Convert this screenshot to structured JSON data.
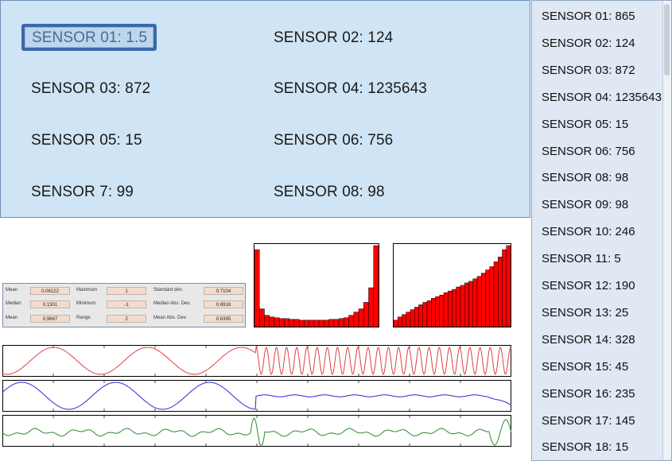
{
  "sensor_grid": [
    {
      "text": "SENSOR 01: 1.5",
      "selected": true
    },
    {
      "text": "SENSOR 02: 124"
    },
    {
      "text": "SENSOR 03: 872"
    },
    {
      "text": "SENSOR 04: 1235643"
    },
    {
      "text": "SENSOR 05: 15"
    },
    {
      "text": "SENSOR 06: 756"
    },
    {
      "text": "SENSOR 7: 99"
    },
    {
      "text": "SENSOR 08: 98"
    }
  ],
  "sensor_list": [
    "SENSOR 01: 865",
    "SENSOR 02: 124",
    "SENSOR 03: 872",
    "SENSOR 04: 1235643",
    "SENSOR 05: 15",
    "SENSOR 06: 756",
    "SENSOR 08: 98",
    "SENSOR 09: 98",
    "SENSOR 10: 246",
    "SENSOR 11: 5",
    "SENSOR 12: 190",
    "SENSOR 13: 25",
    "SENSOR 14: 328",
    "SENSOR 15: 45",
    "SENSOR 16: 235",
    "SENSOR 17: 145",
    "SENSOR 18: 15"
  ],
  "stats": [
    {
      "label": "Mean",
      "value": "0.06122"
    },
    {
      "label": "Maximum",
      "value": "1"
    },
    {
      "label": "Standard dev.",
      "value": "0.7104"
    },
    {
      "label": "Median",
      "value": "0.1301"
    },
    {
      "label": "Minimum",
      "value": "-1"
    },
    {
      "label": "Median Abs. Dev.",
      "value": "0.6918"
    },
    {
      "label": "Mean",
      "value": "0.9667"
    },
    {
      "label": "Range",
      "value": "2"
    },
    {
      "label": "Mean Abs. Dev.",
      "value": "0.6395"
    }
  ],
  "colors": {
    "bar": "#ff0000",
    "trace1": "#e04040",
    "trace2": "#2a2ad8",
    "trace3": "#2a8a2a"
  },
  "chart_data": [
    {
      "type": "bar",
      "values": [
        95,
        22,
        14,
        12,
        11,
        10,
        10,
        9,
        9,
        8,
        8,
        8,
        8,
        8,
        8,
        9,
        9,
        10,
        11,
        14,
        18,
        22,
        30,
        48,
        100
      ]
    },
    {
      "type": "bar",
      "values": [
        8,
        12,
        15,
        18,
        21,
        24,
        27,
        30,
        32,
        35,
        37,
        39,
        42,
        44,
        46,
        49,
        51,
        54,
        56,
        59,
        62,
        66,
        70,
        74,
        80,
        86,
        95,
        100
      ]
    },
    {
      "type": "line",
      "name": "",
      "description_values": "sine"
    },
    {
      "type": "line",
      "name": "",
      "description_values": "sine-decay"
    },
    {
      "type": "line",
      "name": "",
      "description_values": "noise"
    }
  ]
}
